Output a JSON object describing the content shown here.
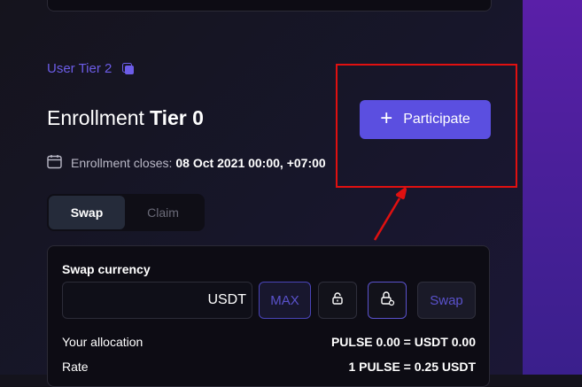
{
  "user_tier": {
    "label": "User Tier 2"
  },
  "enrollment": {
    "title": "Enrollment",
    "tier": "Tier 0"
  },
  "participate": {
    "label": "Participate"
  },
  "closes": {
    "label": "Enrollment closes:",
    "date": "08 Oct 2021 00:00, +07:00"
  },
  "tabs": [
    {
      "label": "Swap",
      "active": true
    },
    {
      "label": "Claim",
      "active": false
    }
  ],
  "swap": {
    "currency_label": "Swap currency",
    "amount_value": "",
    "unit": "USDT",
    "max_label": "MAX",
    "swap_label": "Swap"
  },
  "info": {
    "allocation_label": "Your allocation",
    "allocation_value": "PULSE 0.00 = USDT 0.00",
    "rate_label": "Rate",
    "rate_value": "1 PULSE = 0.25 USDT"
  },
  "icons": {
    "copy": "copy-icon",
    "plus": "plus-icon",
    "calendar": "calendar-icon",
    "lock": "lock-icon",
    "unlock": "unlock-icon"
  },
  "colors": {
    "accent": "#5b4fe0",
    "tier_link": "#6c5ce7",
    "annotation": "#e01010",
    "side_gradient": "#5a1fa8"
  }
}
